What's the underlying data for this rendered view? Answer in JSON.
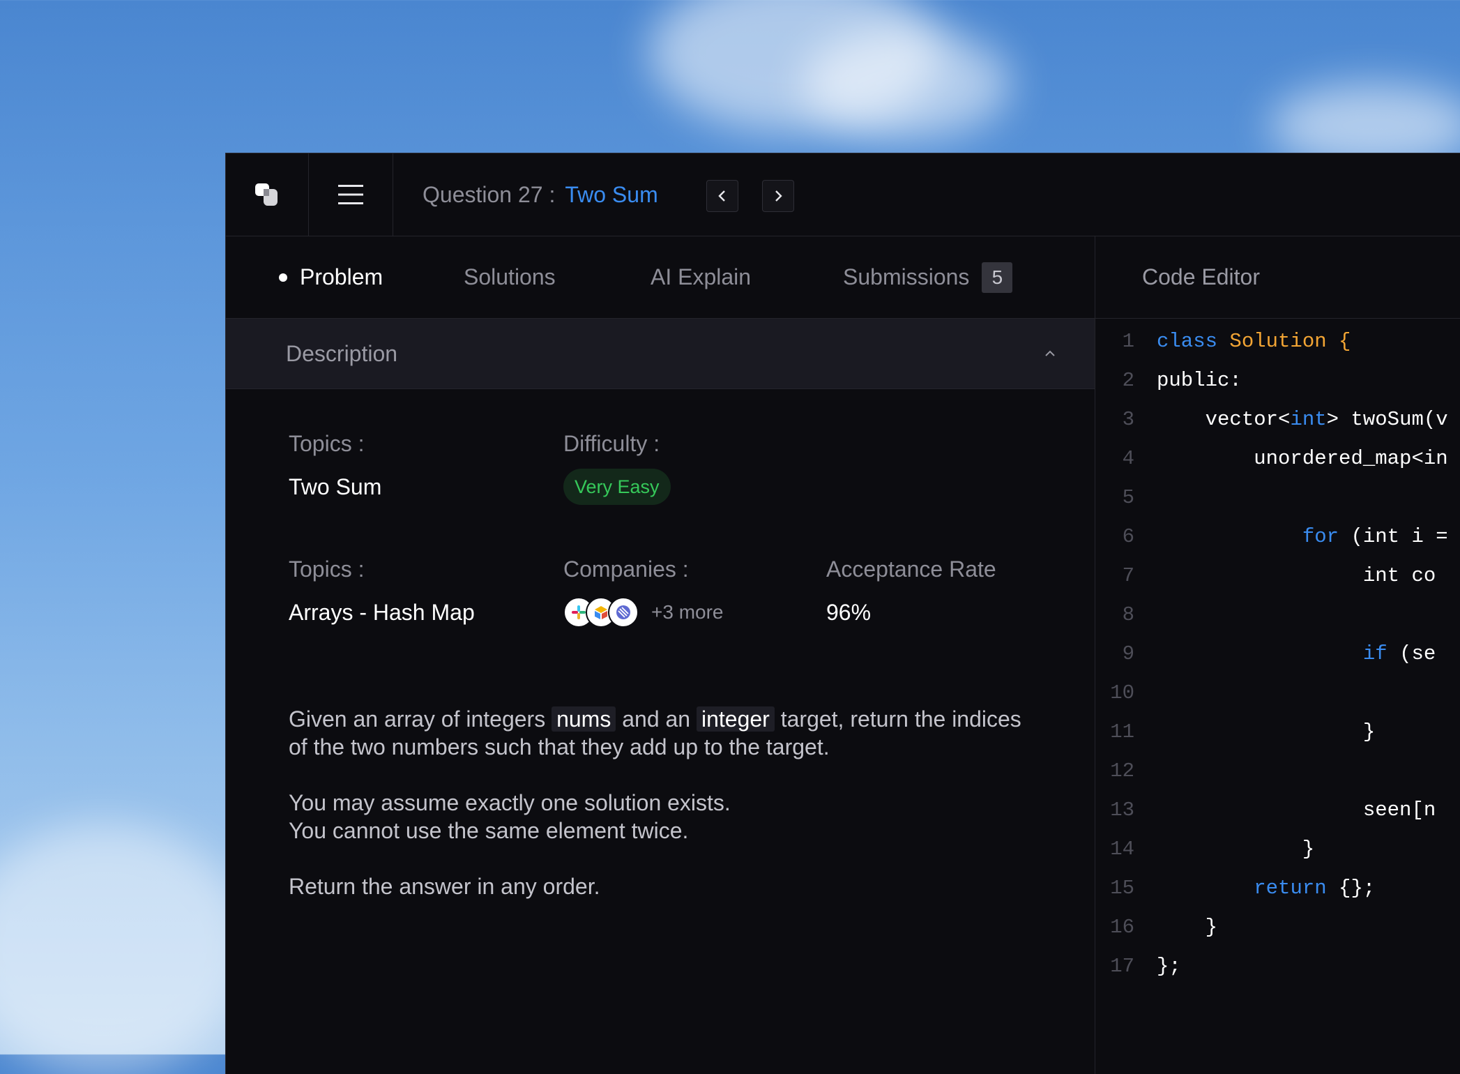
{
  "header": {
    "question_prefix": "Question 27 :",
    "question_name": "Two Sum",
    "prev_icon": "chevron-left-icon",
    "next_icon": "chevron-right-icon"
  },
  "tabs": [
    {
      "label": "Problem",
      "active": true
    },
    {
      "label": "Solutions"
    },
    {
      "label": "AI Explain"
    },
    {
      "label": "Submissions",
      "badge": "5"
    }
  ],
  "description": {
    "title": "Description",
    "topics_label": "Topics :",
    "topics_value": "Two Sum",
    "difficulty_label": "Difficulty :",
    "difficulty_value": "Very Easy",
    "topics2_label": "Topics :",
    "topics2_value": "Arrays - Hash Map",
    "companies_label": "Companies :",
    "companies_more": "+3 more",
    "acceptance_label": "Acceptance Rate",
    "acceptance_value": "96%",
    "p1_a": "Given an array of integers",
    "p1_code1": "nums",
    "p1_b": "and an",
    "p1_code2": "integer",
    "p1_c": "target, return the indices of the two numbers such that they add up to the target.",
    "p2_line1": "You may assume exactly one solution exists.",
    "p2_line2": "You cannot use the same element twice.",
    "p3": "Return the answer in any order."
  },
  "editor": {
    "title": "Code Editor",
    "lines": [
      {
        "n": "1",
        "parts": [
          {
            "t": "class ",
            "c": "kw"
          },
          {
            "t": "Solution {",
            "c": "cls"
          }
        ]
      },
      {
        "n": "2",
        "parts": [
          {
            "t": "public:"
          }
        ]
      },
      {
        "n": "3",
        "parts": [
          {
            "t": "    vector<"
          },
          {
            "t": "int",
            "c": "kw"
          },
          {
            "t": "> twoSum(v"
          }
        ]
      },
      {
        "n": "4",
        "parts": [
          {
            "t": "        unordered_map<in"
          }
        ]
      },
      {
        "n": "5",
        "parts": []
      },
      {
        "n": "6",
        "parts": [
          {
            "t": "            "
          },
          {
            "t": "for",
            "c": "kw"
          },
          {
            "t": " (int i ="
          }
        ]
      },
      {
        "n": "7",
        "parts": [
          {
            "t": "                 int co"
          }
        ]
      },
      {
        "n": "8",
        "parts": []
      },
      {
        "n": "9",
        "parts": [
          {
            "t": "                 "
          },
          {
            "t": "if",
            "c": "kw"
          },
          {
            "t": " (se"
          }
        ]
      },
      {
        "n": "10",
        "parts": []
      },
      {
        "n": "11",
        "parts": [
          {
            "t": "                 }"
          }
        ]
      },
      {
        "n": "12",
        "parts": []
      },
      {
        "n": "13",
        "parts": [
          {
            "t": "                 seen[n"
          }
        ]
      },
      {
        "n": "14",
        "parts": [
          {
            "t": "            }"
          }
        ]
      },
      {
        "n": "15",
        "parts": [
          {
            "t": "        "
          },
          {
            "t": "return",
            "c": "kw"
          },
          {
            "t": " {};"
          }
        ]
      },
      {
        "n": "16",
        "parts": [
          {
            "t": "    }"
          }
        ]
      },
      {
        "n": "17",
        "parts": [
          {
            "t": "};"
          }
        ]
      }
    ]
  },
  "colors": {
    "accent": "#3a8cf0",
    "keyword": "#3a8cf0",
    "class_name": "#f3a534",
    "difficulty": "#36c95a",
    "panel": "#0c0c10"
  }
}
